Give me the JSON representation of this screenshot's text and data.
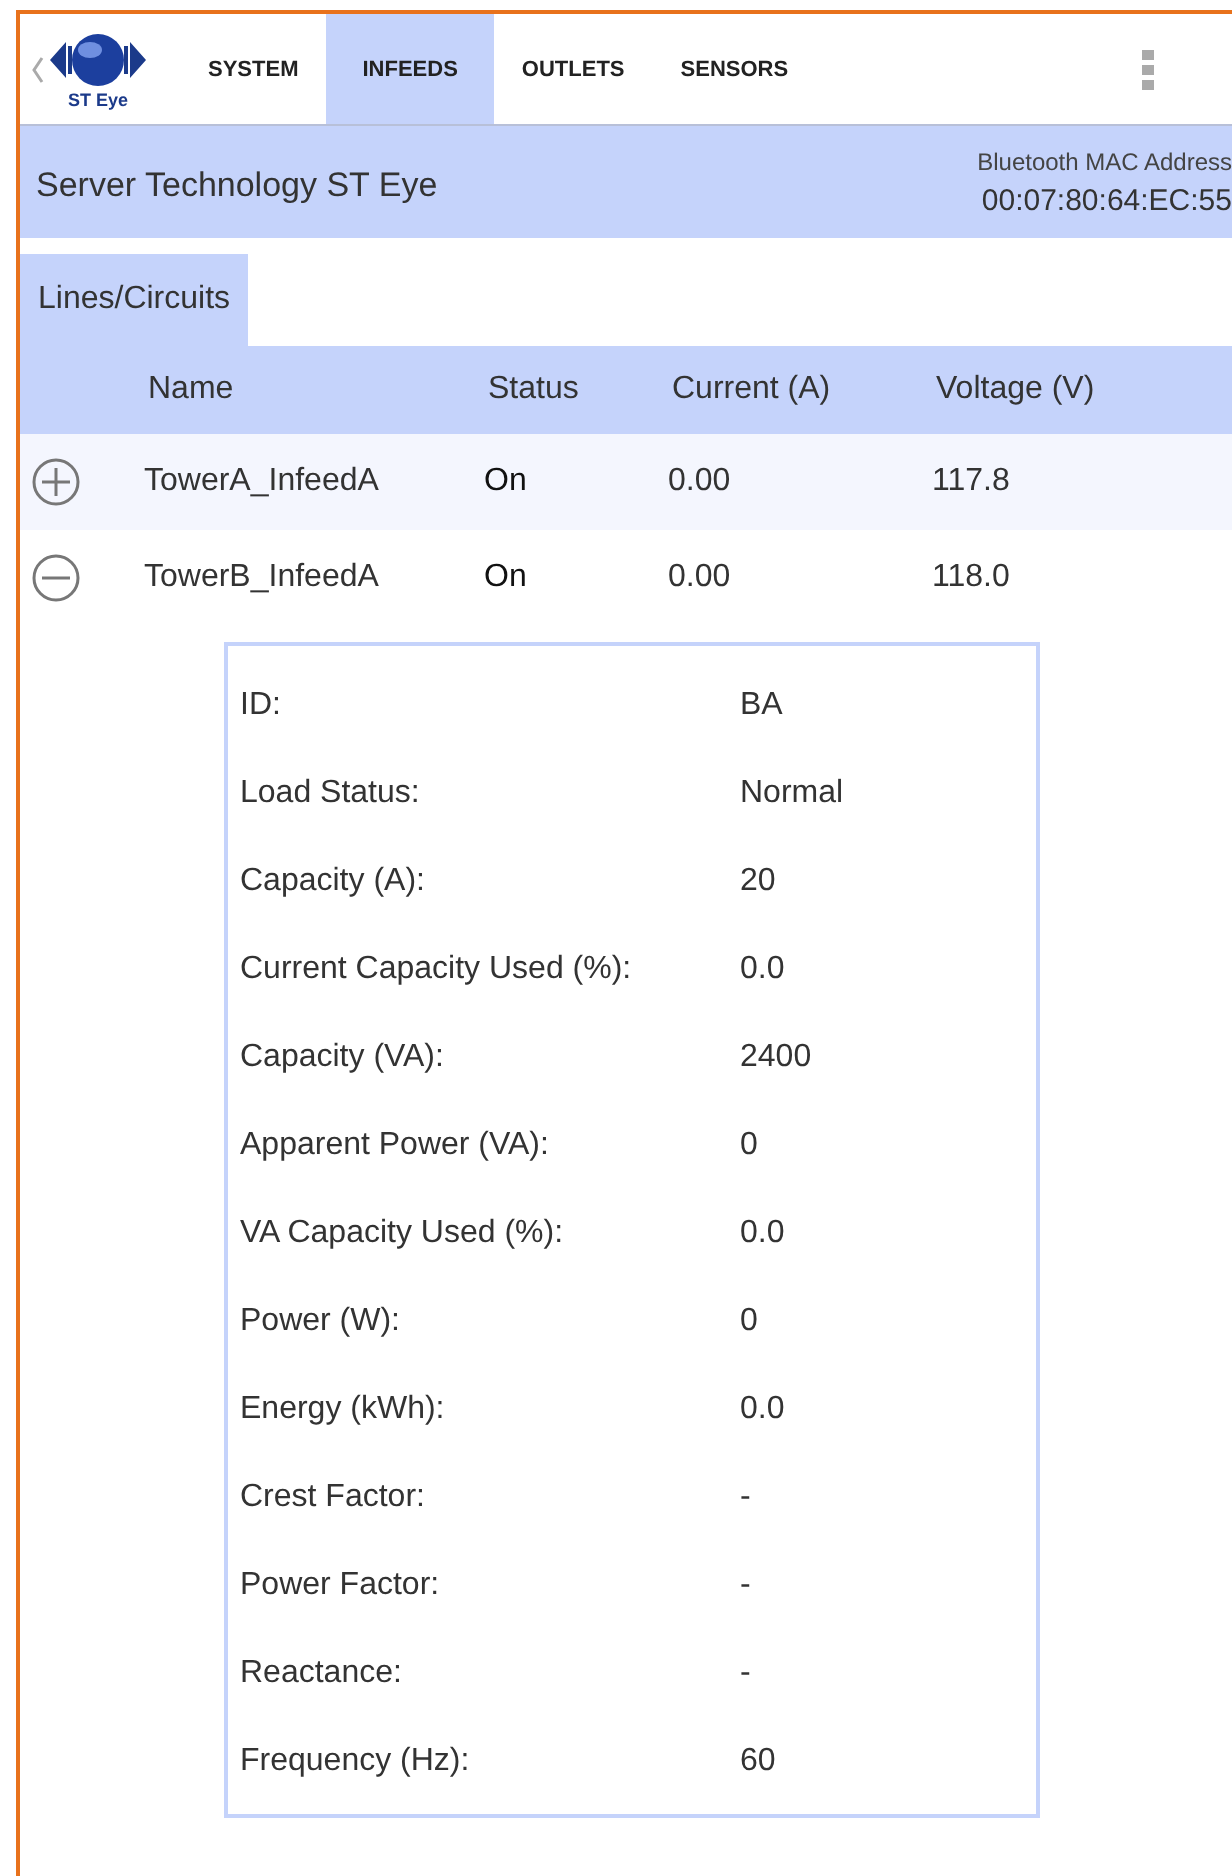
{
  "app": {
    "logo_text": "ST Eye"
  },
  "tabs": [
    {
      "label": "SYSTEM",
      "selected": false
    },
    {
      "label": "INFEEDS",
      "selected": true
    },
    {
      "label": "OUTLETS",
      "selected": false
    },
    {
      "label": "SENSORS",
      "selected": false
    }
  ],
  "header": {
    "title": "Server Technology ST Eye",
    "mac_label": "Bluetooth MAC Address",
    "mac": "00:07:80:64:EC:55"
  },
  "section_tab": {
    "label": "Lines/Circuits",
    "selected": true
  },
  "table": {
    "columns": [
      "Name",
      "Status",
      "Current (A)",
      "Voltage (V)"
    ],
    "rows": [
      {
        "expanded": false,
        "cells": [
          "TowerA_InfeedA",
          "On",
          "0.00",
          "117.8"
        ]
      },
      {
        "expanded": true,
        "cells": [
          "TowerB_InfeedA",
          "On",
          "0.00",
          "118.0"
        ],
        "details": [
          {
            "label": "ID:",
            "value": "BA"
          },
          {
            "label": "Load Status:",
            "value": "Normal"
          },
          {
            "label": "Capacity (A):",
            "value": "20"
          },
          {
            "label": "Current Capacity Used (%):",
            "value": "0.0"
          },
          {
            "label": "Capacity (VA):",
            "value": "2400"
          },
          {
            "label": "Apparent Power (VA):",
            "value": "0"
          },
          {
            "label": "VA Capacity Used (%):",
            "value": "0.0"
          },
          {
            "label": "Power (W):",
            "value": "0"
          },
          {
            "label": "Energy (kWh):",
            "value": "0.0"
          },
          {
            "label": "Crest Factor:",
            "value": "-"
          },
          {
            "label": "Power Factor:",
            "value": "-"
          },
          {
            "label": "Reactance:",
            "value": "-"
          },
          {
            "label": "Frequency (Hz):",
            "value": "60"
          }
        ]
      }
    ]
  }
}
